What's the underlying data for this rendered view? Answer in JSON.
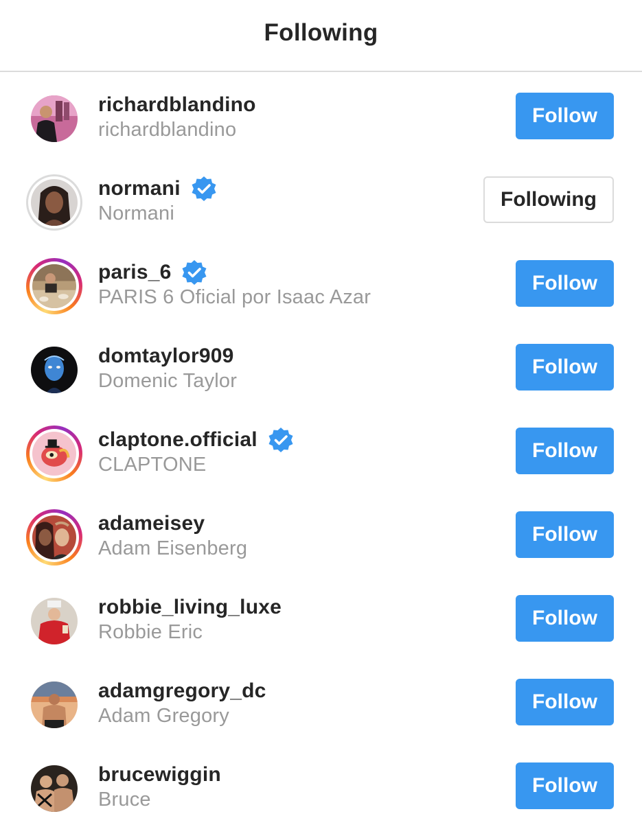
{
  "header": {
    "title": "Following"
  },
  "colors": {
    "follow_button_bg": "#3897f0",
    "verified_badge": "#3897f0",
    "secondary_text": "#999999",
    "primary_text": "#262626",
    "divider": "#dbdbdb"
  },
  "accounts": [
    {
      "username": "richardblandino",
      "full_name": "richardblandino",
      "verified": false,
      "button_label": "Follow",
      "state": "follow",
      "avatar_ring": "none"
    },
    {
      "username": "normani",
      "full_name": "Normani",
      "verified": true,
      "button_label": "Following",
      "state": "following",
      "avatar_ring": "seen"
    },
    {
      "username": "paris_6",
      "full_name": "PARIS 6 Oficial por Isaac Azar",
      "verified": true,
      "button_label": "Follow",
      "state": "follow",
      "avatar_ring": "story"
    },
    {
      "username": "domtaylor909",
      "full_name": "Domenic Taylor",
      "verified": false,
      "button_label": "Follow",
      "state": "follow",
      "avatar_ring": "none"
    },
    {
      "username": "claptone.official",
      "full_name": "CLAPTONE",
      "verified": true,
      "button_label": "Follow",
      "state": "follow",
      "avatar_ring": "story"
    },
    {
      "username": "adameisey",
      "full_name": "Adam Eisenberg",
      "verified": false,
      "button_label": "Follow",
      "state": "follow",
      "avatar_ring": "story"
    },
    {
      "username": "robbie_living_luxe",
      "full_name": "Robbie Eric",
      "verified": false,
      "button_label": "Follow",
      "state": "follow",
      "avatar_ring": "none"
    },
    {
      "username": "adamgregory_dc",
      "full_name": "Adam Gregory",
      "verified": false,
      "button_label": "Follow",
      "state": "follow",
      "avatar_ring": "none"
    },
    {
      "username": "brucewiggin",
      "full_name": "Bruce",
      "verified": false,
      "button_label": "Follow",
      "state": "follow",
      "avatar_ring": "none"
    }
  ]
}
